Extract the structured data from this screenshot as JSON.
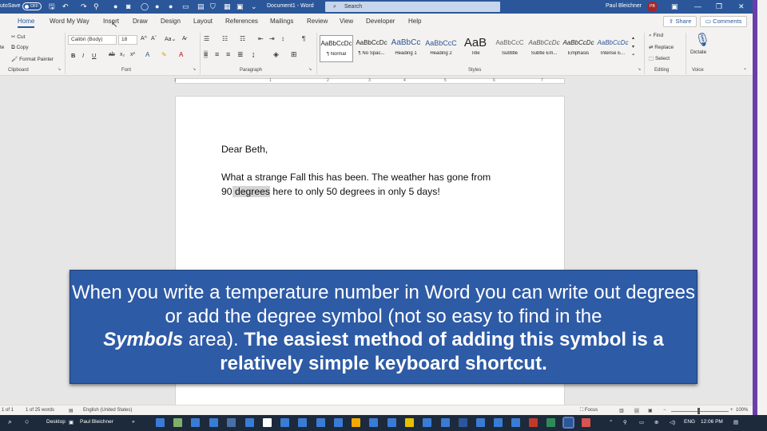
{
  "titlebar": {
    "autosave_label": "utoSave",
    "autosave_state": "OFF",
    "doc_title": "Document1 - Word",
    "search_label": "Search",
    "user_name": "Paul Bleichner",
    "user_initials": "PB"
  },
  "tabs": [
    "Home",
    "Word My Way",
    "Insert",
    "Draw",
    "Design",
    "Layout",
    "References",
    "Mailings",
    "Review",
    "View",
    "Developer",
    "Help"
  ],
  "share_label": "Share",
  "comments_label": "Comments",
  "ribbon": {
    "clipboard": {
      "cut": "Cut",
      "copy": "Copy",
      "format_painter": "Format Painter",
      "paste_partial": "te",
      "group": "Clipboard"
    },
    "font": {
      "name": "Calibri (Body)",
      "size": "18",
      "group": "Font"
    },
    "paragraph": {
      "group": "Paragraph"
    },
    "styles": {
      "group": "Styles",
      "items": [
        {
          "preview": "AaBbCcDc",
          "name": "¶ Normal"
        },
        {
          "preview": "AaBbCcDc",
          "name": "¶ No Spac..."
        },
        {
          "preview": "AaBbCc",
          "name": "Heading 1"
        },
        {
          "preview": "AaBbCcC",
          "name": "Heading 2"
        },
        {
          "preview": "AaB",
          "name": "Title"
        },
        {
          "preview": "AaBbCcC",
          "name": "Subtitle"
        },
        {
          "preview": "AaBbCcDc",
          "name": "Subtle Em..."
        },
        {
          "preview": "AaBbCcDc",
          "name": "Emphasis"
        },
        {
          "preview": "AaBbCcDc",
          "name": "Intense E..."
        }
      ]
    },
    "editing": {
      "find": "Find",
      "replace": "Replace",
      "select": "Select",
      "group": "Editing"
    },
    "voice": {
      "dictate": "Dictate",
      "group": "Voice"
    }
  },
  "ruler_marks": [
    "1",
    "1",
    "2",
    "3",
    "4",
    "5",
    "6",
    "7"
  ],
  "document": {
    "greeting": "Dear Beth,",
    "line1": "What a strange Fall this has been. The weather has gone from",
    "line2_pre": "90",
    "line2_highlight": " degrees",
    "line2_post": " here to only 50 degrees in only 5 days!"
  },
  "caption": {
    "part1": "When you write a temperature number in Word you can write out degrees or add the degree symbol (not so easy to find in the",
    "italic_bold": "Symbols",
    "part2": " area).",
    "bold": " The easiest method of adding this symbol is a relatively simple keyboard shortcut."
  },
  "status": {
    "page": "1 of 1",
    "words": "1 of 25 words",
    "language": "English (United States)",
    "focus": "Focus",
    "zoom": "100%"
  },
  "taskbar": {
    "desktop": "Desktop",
    "user": "Paul Bleichner",
    "lang": "ENG",
    "time": "12:06 PM"
  },
  "colors": {
    "word_blue": "#2b579a",
    "caption_bg": "#2e5ba6",
    "accent_purple": "#6b3fa8"
  }
}
